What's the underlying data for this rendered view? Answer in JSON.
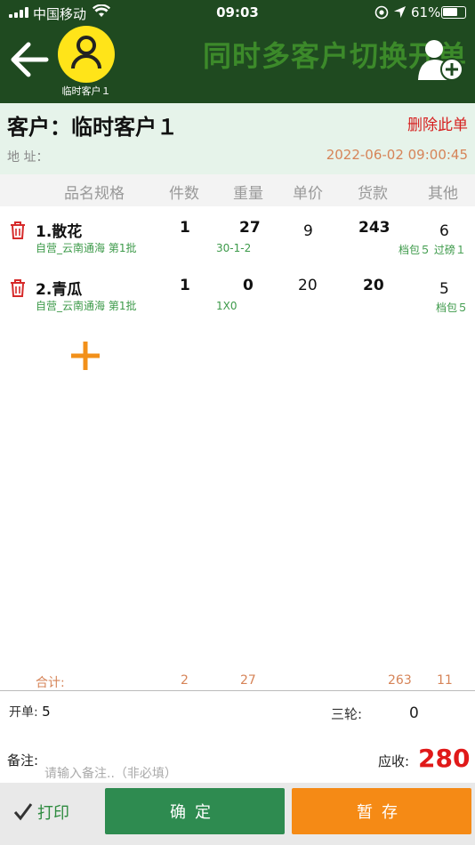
{
  "status_bar": {
    "carrier": "中国移动",
    "time": "09:03",
    "battery": "61%"
  },
  "header": {
    "customer_avatar_label": "临时客户１",
    "banner": "同时多客户切换开单",
    "icons": [
      "back-arrow-icon",
      "user-icon",
      "add-user-icon"
    ]
  },
  "customer": {
    "name": "客户：临时客户１",
    "delete_label": "删除此单",
    "address_label": "地 址：",
    "datetime": "2022-06-02 09:00:45"
  },
  "table": {
    "headers": [
      "品名规格",
      "件数",
      "重量",
      "单价",
      "货款",
      "其他"
    ],
    "rows": [
      {
        "name": "1.散花",
        "sub": "自营_云南通海 第1批",
        "count": "1",
        "weight": "27",
        "weight_detail": "30-1-2",
        "price": "9",
        "amount": "243",
        "other": "6",
        "other_detail": "档包５ 过磅１"
      },
      {
        "name": "2.青瓜",
        "sub": "自营_云南通海 第1批",
        "count": "1",
        "weight": "0",
        "weight_detail": "1X0",
        "price": "20",
        "amount": "20",
        "other": "5",
        "other_detail": "档包５"
      }
    ]
  },
  "totals": {
    "label": "合计:",
    "count": "2",
    "weight": "27",
    "amount": "263",
    "other": "11"
  },
  "footer": {
    "open_label": "开单:",
    "open_value": "5",
    "three_label": "三轮:",
    "three_value": "0",
    "note_label": "备注:",
    "note_placeholder": "请输入备注..（非必填）",
    "due_label": "应收:",
    "due_value": "280"
  },
  "actions": {
    "print": "打印",
    "confirm": "确定",
    "save": "暂存"
  },
  "colors": {
    "header_bg": "#1f4a20",
    "accent_green": "#2e8b50",
    "accent_orange": "#f58a15",
    "danger": "#e01919"
  }
}
